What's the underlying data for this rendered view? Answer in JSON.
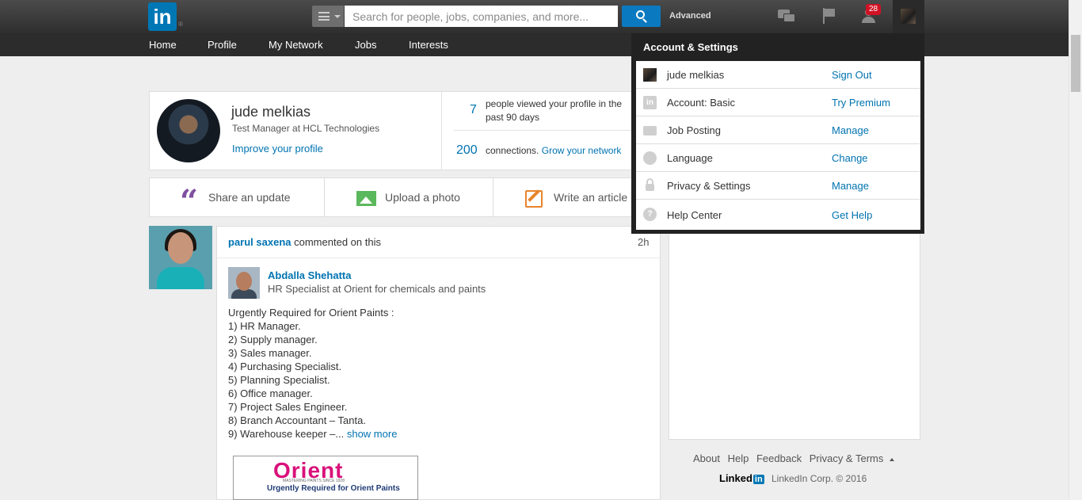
{
  "header": {
    "logo_text": "in",
    "logo_reg": "®",
    "search_placeholder": "Search for people, jobs, companies, and more...",
    "advanced_label": "Advanced",
    "notification_count": "28",
    "icons": [
      "messages-icon",
      "flag-icon",
      "add-connection-icon"
    ]
  },
  "nav": {
    "items": [
      "Home",
      "Profile",
      "My Network",
      "Jobs",
      "Interests"
    ]
  },
  "profile": {
    "name": "jude melkias",
    "title": "Test Manager at HCL Technologies",
    "improve_link": "Improve your profile",
    "views_count": "7",
    "views_text_1": "people viewed your profile in the",
    "views_text_2": "past 90 days",
    "connections_count": "200",
    "connections_text": "connections.",
    "grow_link": "Grow your network"
  },
  "share": {
    "update_label": "Share an update",
    "photo_label": "Upload a photo",
    "article_label": "Write an article"
  },
  "feed": {
    "actor_name": "parul saxena",
    "action_text": "commented on this",
    "time": "2h",
    "author_name": "Abdalla Shehatta",
    "author_title": "HR Specialist at Orient for chemicals and paints",
    "post_lines": [
      "Urgently Required for Orient Paints :",
      "1) HR Manager.",
      "2) Supply manager.",
      "3) Sales manager.",
      "4) Purchasing Specialist.",
      "5) Planning Specialist.",
      "6) Office manager.",
      "7) Project Sales Engineer.",
      "8) Branch Accountant – Tanta."
    ],
    "last_line": "9) Warehouse keeper –...",
    "show_more": "show more",
    "image_logo": "Orient",
    "image_tagline": "MASTERING PAINTS SINCE 1928",
    "image_caption": "Urgently Required for Orient Paints"
  },
  "dropdown": {
    "title": "Account & Settings",
    "rows": [
      {
        "label": "jude melkias",
        "action": "Sign Out",
        "icon": "profile-photo-icon"
      },
      {
        "label": "Account: Basic",
        "action": "Try Premium",
        "icon": "linkedin-icon"
      },
      {
        "label": "Job Posting",
        "action": "Manage",
        "icon": "briefcase-icon"
      },
      {
        "label": "Language",
        "action": "Change",
        "icon": "globe-icon"
      },
      {
        "label": "Privacy & Settings",
        "action": "Manage",
        "icon": "lock-icon"
      },
      {
        "label": "Help Center",
        "action": "Get Help",
        "icon": "help-icon"
      }
    ]
  },
  "footer": {
    "links": [
      "About",
      "Help",
      "Feedback",
      "Privacy & Terms"
    ],
    "brand_text": "Linked",
    "brand_in": "in",
    "copyright": "LinkedIn Corp. © 2016"
  },
  "colors": {
    "brand_blue": "#0077b5",
    "link_blue": "#0073b1",
    "badge_red": "#d11124",
    "topbar": "#3a3a3a"
  }
}
